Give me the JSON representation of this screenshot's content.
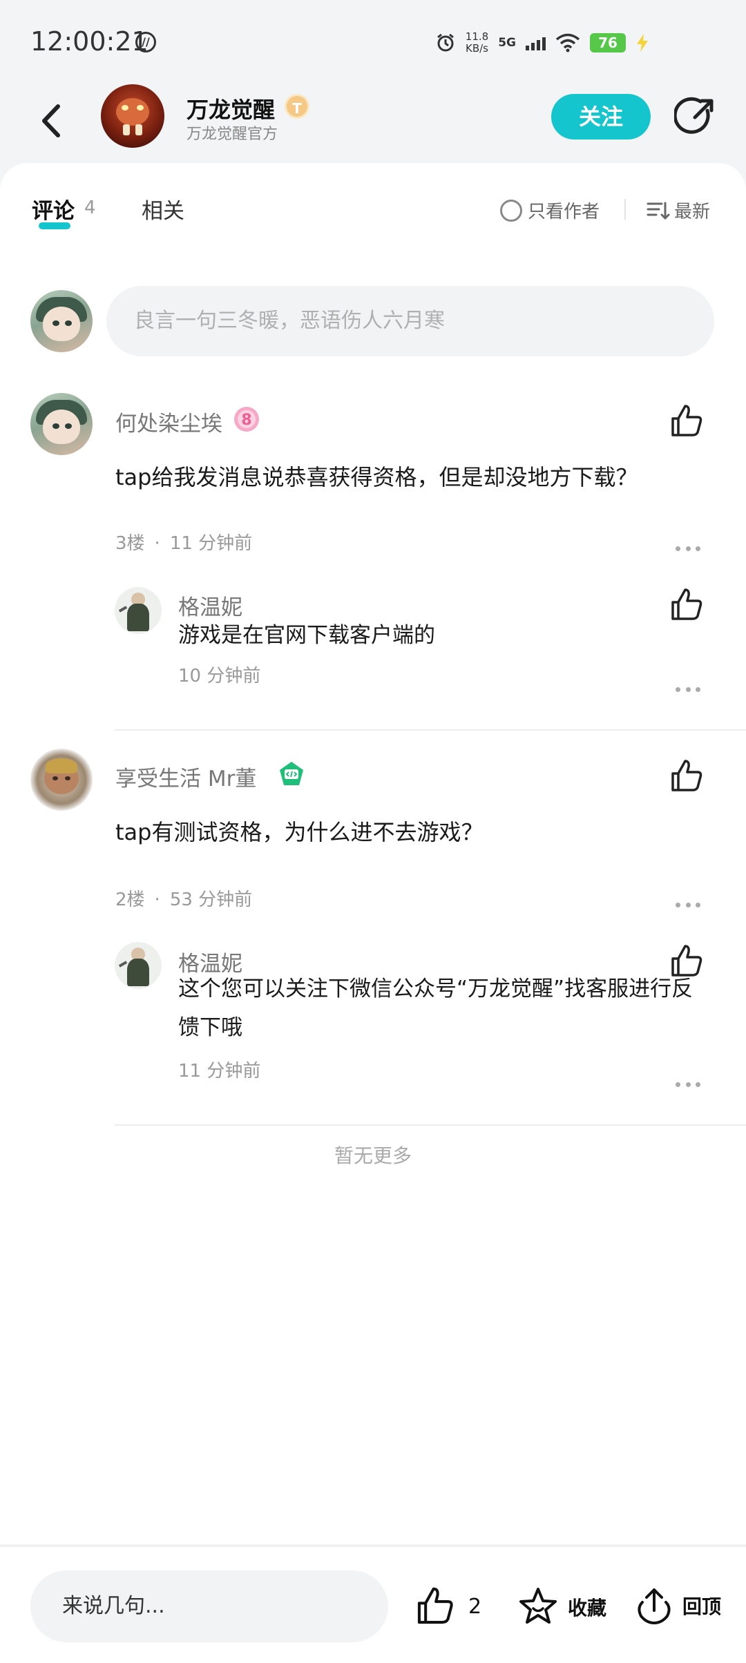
{
  "status_bar": {
    "time": "12:00:21",
    "net_speed_value": "11.8",
    "net_speed_unit": "KB/s",
    "network": "5G",
    "battery": "76",
    "icons": [
      "data-saver-icon",
      "alarm-icon",
      "signal-icon",
      "wifi-icon",
      "battery-icon",
      "charging-icon"
    ]
  },
  "header": {
    "game_name": "万龙觉醒",
    "verified_badge": "T",
    "subtitle": "万龙觉醒官方",
    "follow_label": "关注",
    "accent_color": "#15c5ce"
  },
  "tabs": {
    "comments_label": "评论",
    "comments_count": "4",
    "related_label": "相关",
    "only_author_label": "只看作者",
    "sort_label": "最新"
  },
  "composer": {
    "placeholder": "良言一句三冬暖，恶语伤人六月寒"
  },
  "comments": [
    {
      "user": "何处染尘埃",
      "level": "8",
      "text": "tap给我发消息说恭喜获得资格，但是却没地方下载？",
      "floor": "3楼",
      "time": "11 分钟前",
      "reply": {
        "user": "格温妮",
        "text": "游戏是在官网下载客户端的",
        "time": "10 分钟前"
      }
    },
    {
      "user": "享受生活   Mr董",
      "text": "tap有测试资格，为什么进不去游戏？",
      "floor": "2楼",
      "time": "53 分钟前",
      "reply": {
        "user": "格温妮",
        "text": "这个您可以关注下微信公众号“万龙觉醒”找客服进行反馈下哦",
        "time": "11 分钟前"
      }
    }
  ],
  "footer_text": "暂无更多",
  "bottom_bar": {
    "input_placeholder": "来说几句...",
    "like_count": "2",
    "favorite_label": "收藏",
    "top_label": "回顶"
  }
}
